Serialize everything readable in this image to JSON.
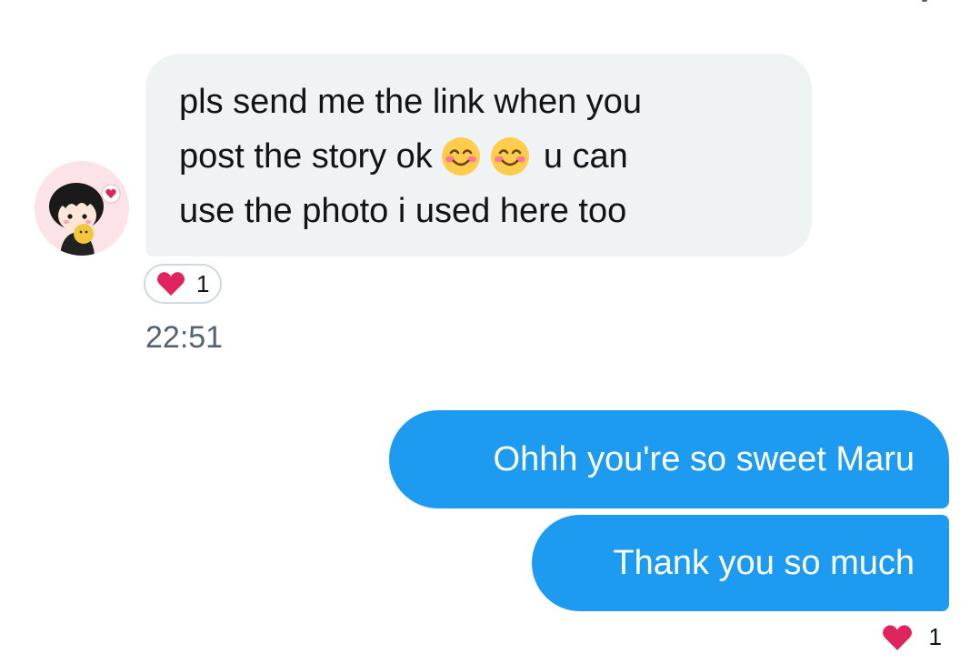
{
  "conversation": {
    "incoming": {
      "lines": [
        "pls send me the link when you",
        "post the story ok",
        "u can",
        "use the photo i used here too"
      ],
      "emoji": [
        "smiling-face-with-smiling-eyes",
        "smiling-face-with-smiling-eyes"
      ],
      "reaction": {
        "icon": "heart-icon",
        "count": "1"
      },
      "timestamp": "22:51"
    },
    "outgoing": [
      {
        "text": "Ohhh you're so sweet Maru"
      },
      {
        "text": "Thank you so much"
      }
    ],
    "outgoing_reaction": {
      "icon": "heart-icon",
      "count": "1"
    }
  },
  "colors": {
    "incoming_bubble": "#eff3f4",
    "outgoing_bubble": "#1d9bf0",
    "heart": "#e0245e",
    "timestamp": "#536471"
  }
}
